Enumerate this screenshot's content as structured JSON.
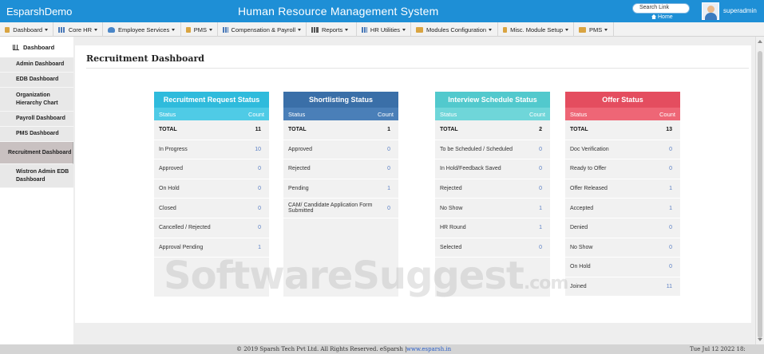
{
  "header": {
    "brand": "EsparshDemo",
    "system_title": "Human Resource Management System",
    "search_placeholder": "Search Link",
    "home_label": "Home",
    "username": "superadmin"
  },
  "menu": [
    {
      "label": "Dashboard",
      "icon": "folder-icon"
    },
    {
      "label": "Core HR",
      "icon": "grid-icon"
    },
    {
      "label": "Employee Services",
      "icon": "people-icon"
    },
    {
      "label": "PMS",
      "icon": "folder-icon"
    },
    {
      "label": "Compensation & Payroll",
      "icon": "grid-icon"
    },
    {
      "label": "Reports",
      "icon": "bar-chart-icon"
    },
    {
      "label": "HR Utilities",
      "icon": "grid-icon"
    },
    {
      "label": "Modules Configuration",
      "icon": "folder-icon"
    },
    {
      "label": "Misc. Module Setup",
      "icon": "folder-icon"
    },
    {
      "label": "PMS",
      "icon": "folder-icon"
    }
  ],
  "sidebar": {
    "heading": "Dashboard",
    "items": [
      {
        "label": "Admin Dashboard"
      },
      {
        "label": "EDB Dashboard"
      },
      {
        "label": "Organization Hierarchy Chart"
      },
      {
        "label": "Payroll Dashboard"
      },
      {
        "label": "PMS Dashboard"
      },
      {
        "label": "Recruitment Dashboard"
      },
      {
        "label": "Wistron Admin EDB Dashboard"
      }
    ]
  },
  "main": {
    "page_title": "Recruitment Dashboard",
    "cards": [
      {
        "title": "Recruitment Request Status",
        "col_status": "Status",
        "col_count": "Count",
        "rows": [
          {
            "label": "TOTAL",
            "count": "11"
          },
          {
            "label": "In Progress",
            "count": "10"
          },
          {
            "label": "Approved",
            "count": "0"
          },
          {
            "label": "On Hold",
            "count": "0"
          },
          {
            "label": "Closed",
            "count": "0"
          },
          {
            "label": "Cancelled / Rejected",
            "count": "0"
          },
          {
            "label": "Approval Pending",
            "count": "1"
          }
        ]
      },
      {
        "title": "Shortlisting Status",
        "col_status": "Status",
        "col_count": "Count",
        "rows": [
          {
            "label": "TOTAL",
            "count": "1"
          },
          {
            "label": "Approved",
            "count": "0"
          },
          {
            "label": "Rejected",
            "count": "0"
          },
          {
            "label": "Pending",
            "count": "1"
          },
          {
            "label": "CAM/ Candidate Application Form Submitted",
            "count": "0"
          }
        ]
      },
      {
        "title": "Interview Schedule Status",
        "col_status": "Status",
        "col_count": "Count",
        "rows": [
          {
            "label": "TOTAL",
            "count": "2"
          },
          {
            "label": "To be Scheduled / Scheduled",
            "count": "0"
          },
          {
            "label": "In Hold/Feedback Saved",
            "count": "0"
          },
          {
            "label": "Rejected",
            "count": "0"
          },
          {
            "label": "No Show",
            "count": "1"
          },
          {
            "label": "HR Round",
            "count": "1"
          },
          {
            "label": "Selected",
            "count": "0"
          }
        ]
      },
      {
        "title": "Offer Status",
        "col_status": "Status",
        "col_count": "Count",
        "rows": [
          {
            "label": "TOTAL",
            "count": "13"
          },
          {
            "label": "Doc Verification",
            "count": "0"
          },
          {
            "label": "Ready to Offer",
            "count": "0"
          },
          {
            "label": "Offer Released",
            "count": "1"
          },
          {
            "label": "Accepted",
            "count": "1"
          },
          {
            "label": "Denied",
            "count": "0"
          },
          {
            "label": "No Show",
            "count": "0"
          },
          {
            "label": "On Hold",
            "count": "0"
          },
          {
            "label": "Joined",
            "count": "11"
          }
        ]
      }
    ]
  },
  "watermark": {
    "text": "SoftwareSuggest",
    "suffix": ".com"
  },
  "footer": {
    "copyright": "© 2019 Sparsh Tech Pvt Ltd. All Rights Reserved. eSparsh |",
    "link": "www.esparsh.in",
    "date": "Tue Jul 12 2022 18:"
  },
  "colors": {
    "header_blue": "#1e8fd6",
    "card1": "#2fbbdc",
    "card2": "#3a6fa8",
    "card3": "#52c9cd",
    "card4": "#e44d5f"
  }
}
